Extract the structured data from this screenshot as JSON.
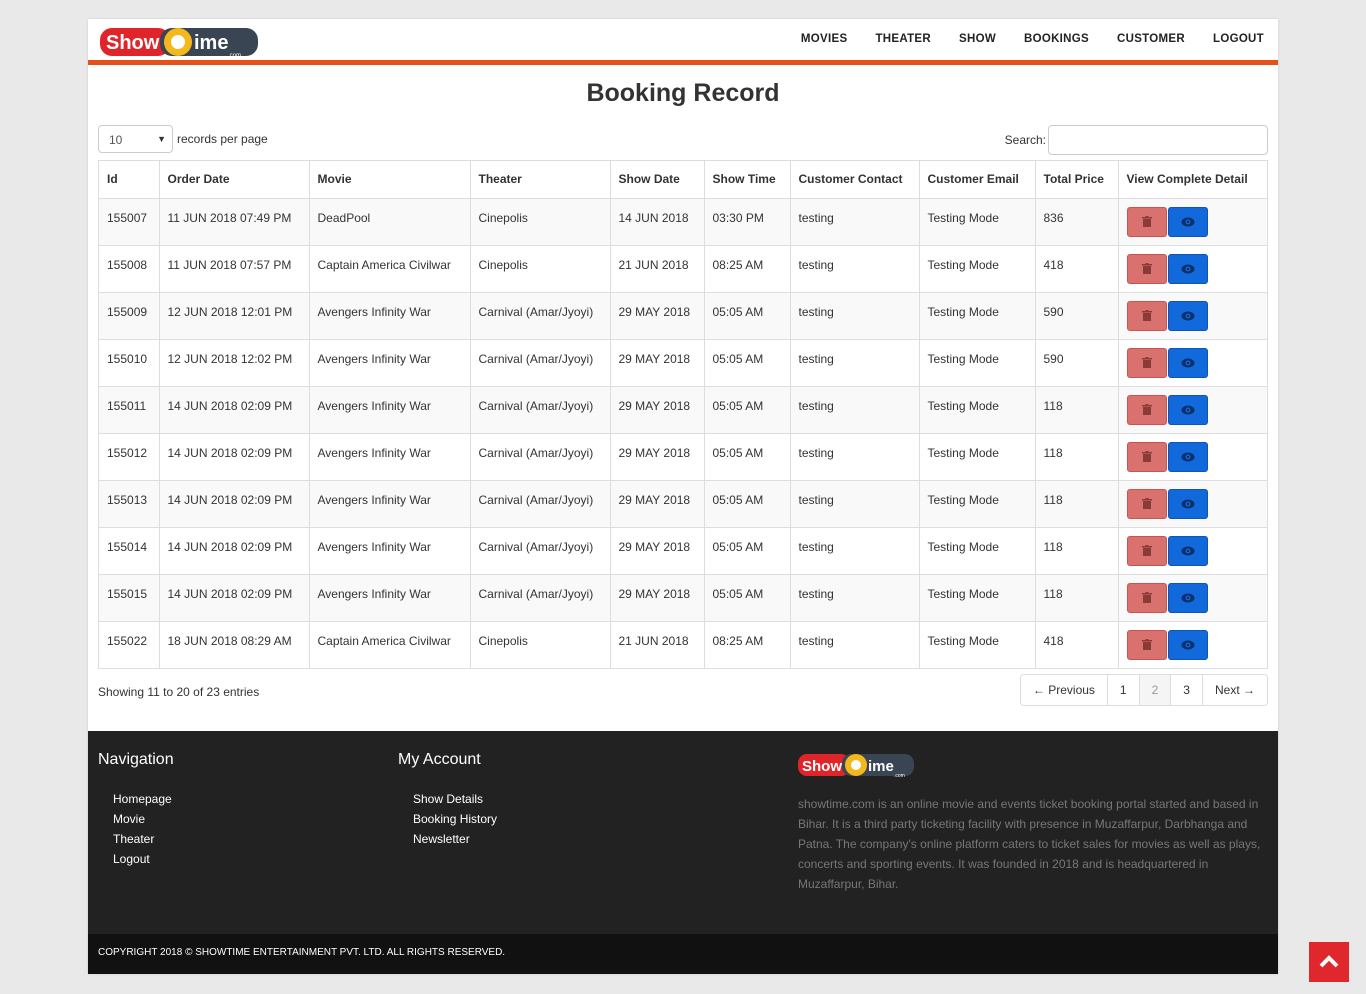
{
  "nav": {
    "items": [
      "MOVIES",
      "THEATER",
      "SHOW",
      "BOOKINGS",
      "CUSTOMER",
      "LOGOUT"
    ]
  },
  "logo": {
    "part1": "Show",
    "part2": "ime",
    "suffix": ".com"
  },
  "page_title": "Booking Record",
  "length_control": {
    "value": "10",
    "label": "records per page"
  },
  "search": {
    "label": "Search:",
    "value": ""
  },
  "table": {
    "headers": [
      "Id",
      "Order Date",
      "Movie",
      "Theater",
      "Show Date",
      "Show Time",
      "Customer Contact",
      "Customer Email",
      "Total Price",
      "View Complete Detail"
    ],
    "rows": [
      [
        "155007",
        "11 JUN 2018 07:49 PM",
        "DeadPool",
        "Cinepolis",
        "14 JUN 2018",
        "03:30 PM",
        "testing",
        "Testing Mode",
        "836"
      ],
      [
        "155008",
        "11 JUN 2018 07:57 PM",
        "Captain America Civilwar",
        "Cinepolis",
        "21 JUN 2018",
        "08:25 AM",
        "testing",
        "Testing Mode",
        "418"
      ],
      [
        "155009",
        "12 JUN 2018 12:01 PM",
        "Avengers Infinity War",
        "Carnival (Amar/Jyoyi)",
        "29 MAY 2018",
        "05:05 AM",
        "testing",
        "Testing Mode",
        "590"
      ],
      [
        "155010",
        "12 JUN 2018 12:02 PM",
        "Avengers Infinity War",
        "Carnival (Amar/Jyoyi)",
        "29 MAY 2018",
        "05:05 AM",
        "testing",
        "Testing Mode",
        "590"
      ],
      [
        "155011",
        "14 JUN 2018 02:09 PM",
        "Avengers Infinity War",
        "Carnival (Amar/Jyoyi)",
        "29 MAY 2018",
        "05:05 AM",
        "testing",
        "Testing Mode",
        "118"
      ],
      [
        "155012",
        "14 JUN 2018 02:09 PM",
        "Avengers Infinity War",
        "Carnival (Amar/Jyoyi)",
        "29 MAY 2018",
        "05:05 AM",
        "testing",
        "Testing Mode",
        "118"
      ],
      [
        "155013",
        "14 JUN 2018 02:09 PM",
        "Avengers Infinity War",
        "Carnival (Amar/Jyoyi)",
        "29 MAY 2018",
        "05:05 AM",
        "testing",
        "Testing Mode",
        "118"
      ],
      [
        "155014",
        "14 JUN 2018 02:09 PM",
        "Avengers Infinity War",
        "Carnival (Amar/Jyoyi)",
        "29 MAY 2018",
        "05:05 AM",
        "testing",
        "Testing Mode",
        "118"
      ],
      [
        "155015",
        "14 JUN 2018 02:09 PM",
        "Avengers Infinity War",
        "Carnival (Amar/Jyoyi)",
        "29 MAY 2018",
        "05:05 AM",
        "testing",
        "Testing Mode",
        "118"
      ],
      [
        "155022",
        "18 JUN 2018 08:29 AM",
        "Captain America Civilwar",
        "Cinepolis",
        "21 JUN 2018",
        "08:25 AM",
        "testing",
        "Testing Mode",
        "418"
      ]
    ],
    "action_icons": [
      "trash-icon",
      "eye-icon"
    ]
  },
  "info": "Showing 11 to 20 of 23 entries",
  "pagination": {
    "prev": "← Previous",
    "pages": [
      "1",
      "2",
      "3"
    ],
    "active": "2",
    "next": "Next →"
  },
  "footer": {
    "navigation": {
      "title": "Navigation",
      "links": [
        "Homepage",
        "Movie",
        "Theater",
        "Logout"
      ]
    },
    "account": {
      "title": "My Account",
      "links": [
        "Show Details",
        "Booking History",
        "Newsletter"
      ]
    },
    "about": "showtime.com is an online movie and events ticket booking portal started and based in Bihar. It is a third party ticketing facility with presence in Muzaffarpur, Darbhanga and Patna. The company's online platform caters to ticket sales for movies as well as plays, concerts and sporting events. It was founded in 2018 and is headquartered in Muzaffarpur, Bihar.",
    "copyright": "COPYRIGHT 2018 © SHOWTIME ENTERTAINMENT PVT. LTD. ALL RIGHTS RESERVED."
  },
  "colors": {
    "accent": "#e8501a",
    "delete": "#d9726e",
    "view": "#1269db",
    "footer": "#222222",
    "scrolltop": "#e0272b"
  }
}
